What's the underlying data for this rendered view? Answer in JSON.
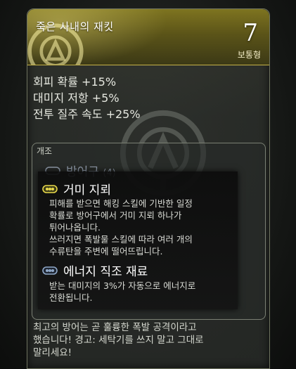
{
  "item": {
    "name": "죽은 사내의 재킷",
    "rarity_number": "7",
    "rarity_label": "보통형"
  },
  "stats": [
    "회피 확률 +15%",
    "대미지 저항 +5%",
    "전투 질주 속도 +25%"
  ],
  "mods": {
    "tab_label": "개조",
    "slot_type": "방어구",
    "slot_count": "(4)",
    "entries": [
      {
        "name": "거미 지뢰",
        "icon": "mod-chip-yellow-icon",
        "desc": [
          "피해를 받으면 해킹 스킬에 기반한 일정",
          "확률로 방어구에서 거미 지뢰 하나가",
          "튀어나옵니다.",
          "쓰러지면 폭발물 스킬에 따라 여러 개의",
          "수류탄을 주변에 떨어뜨립니다."
        ]
      },
      {
        "name": "에너지 직조 재료",
        "icon": "mod-chip-blue-icon",
        "desc": [
          "받는 대미지의 3%가 자동으로 에너지로",
          "전환됩니다."
        ]
      }
    ]
  },
  "flavor": [
    "최고의 방어는 곧 훌륭한 폭발 공격이라고",
    "했습니다! 경고: 세탁기를 쓰지 말고 그대로",
    "말리세요!"
  ],
  "colors": {
    "header_gold": "#7e7420",
    "border": "#6f7460",
    "slot_type_blue": "#8f99a8",
    "mod_yellow": "#e8d84a"
  }
}
